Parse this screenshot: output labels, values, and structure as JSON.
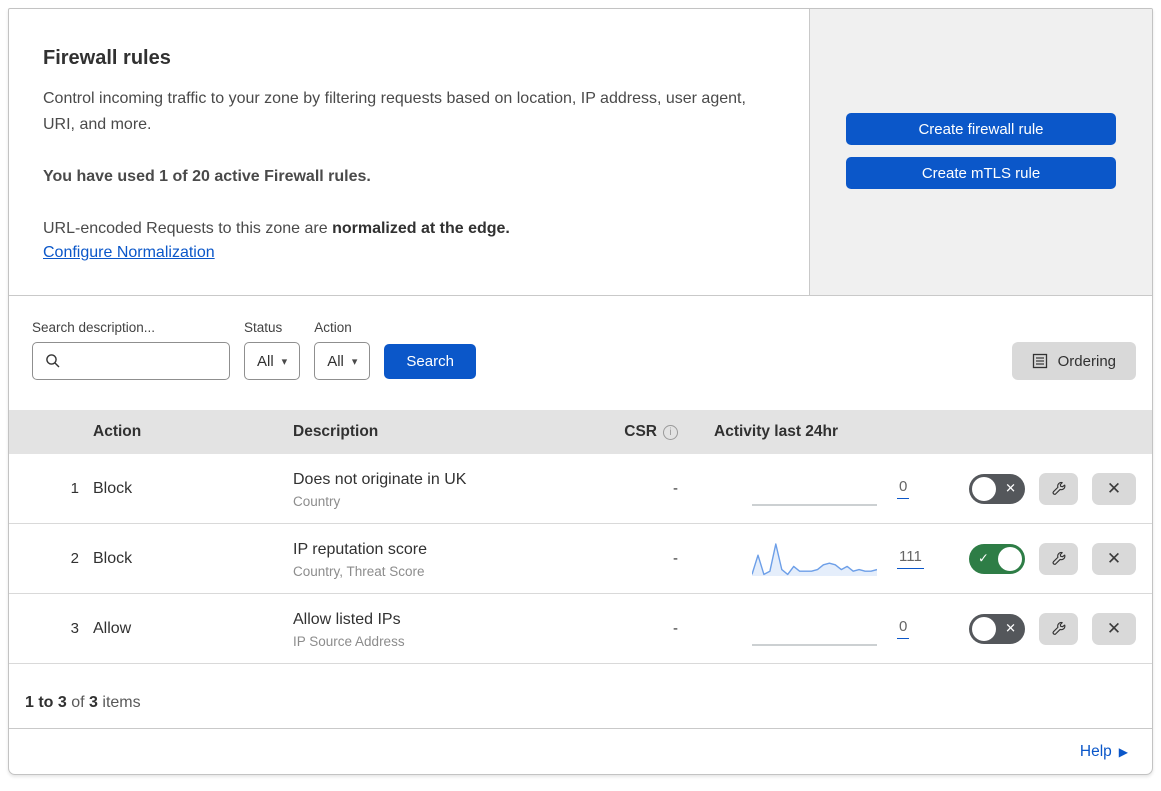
{
  "header": {
    "title": "Firewall rules",
    "description": "Control incoming traffic to your zone by filtering requests based on location, IP address, user agent, URI, and more.",
    "usage": "You have used 1 of 20 active Firewall rules.",
    "normalization_prefix": "URL-encoded Requests to this zone are ",
    "normalization_bold": "normalized at the edge.",
    "normalization_link": "Configure Normalization"
  },
  "actions": {
    "create_firewall_rule": "Create firewall rule",
    "create_mtls_rule": "Create mTLS rule"
  },
  "filters": {
    "search_label": "Search description...",
    "search_value": "",
    "status_label": "Status",
    "status_value": "All",
    "action_label": "Action",
    "action_value": "All",
    "search_button": "Search",
    "ordering_button": "Ordering"
  },
  "table": {
    "columns": {
      "action": "Action",
      "description": "Description",
      "csr": "CSR",
      "activity": "Activity last 24hr"
    },
    "rows": [
      {
        "number": "1",
        "action": "Block",
        "title": "Does not originate in UK",
        "subtitle": "Country",
        "csr": "-",
        "activity_count": "0",
        "enabled": false,
        "sparkline": [
          0,
          0,
          0,
          0,
          0,
          0,
          0,
          0,
          0,
          0,
          0,
          0,
          0,
          0,
          0,
          0,
          0,
          0,
          0,
          0,
          0,
          0
        ]
      },
      {
        "number": "2",
        "action": "Block",
        "title": "IP reputation score",
        "subtitle": "Country, Threat Score",
        "csr": "-",
        "activity_count": "111",
        "enabled": true,
        "sparkline": [
          1,
          13,
          1,
          3,
          20,
          4,
          1,
          6,
          3,
          3,
          3,
          4,
          7,
          8,
          7,
          4,
          6,
          3,
          4,
          3,
          3,
          4
        ]
      },
      {
        "number": "3",
        "action": "Allow",
        "title": "Allow listed IPs",
        "subtitle": "IP Source Address",
        "csr": "-",
        "activity_count": "0",
        "enabled": false,
        "sparkline": [
          0,
          0,
          0,
          0,
          0,
          0,
          0,
          0,
          0,
          0,
          0,
          0,
          0,
          0,
          0,
          0,
          0,
          0,
          0,
          0,
          0,
          0
        ]
      }
    ]
  },
  "footer": {
    "range_bold": "1 to 3",
    "of_text": "of",
    "total_bold": "3",
    "items_text": "items"
  },
  "help": {
    "label": "Help"
  },
  "icons": {
    "search": "magnifier",
    "ordering": "list-document",
    "csr_info": "i",
    "dropdown_caret": "▾",
    "toggle_on_glyph": "✓",
    "toggle_off_glyph": "✕",
    "wrench": "wrench",
    "delete_glyph": "✕",
    "help_arrow": "▶"
  },
  "colors": {
    "accent_blue": "#0b57c9",
    "toggle_on_green": "#2e7d46",
    "toggle_off_gray": "#54575b",
    "sparkline_blue": "#6d9fe8",
    "panel_gray": "#f0f0f0",
    "table_header_gray": "#e3e3e3"
  }
}
